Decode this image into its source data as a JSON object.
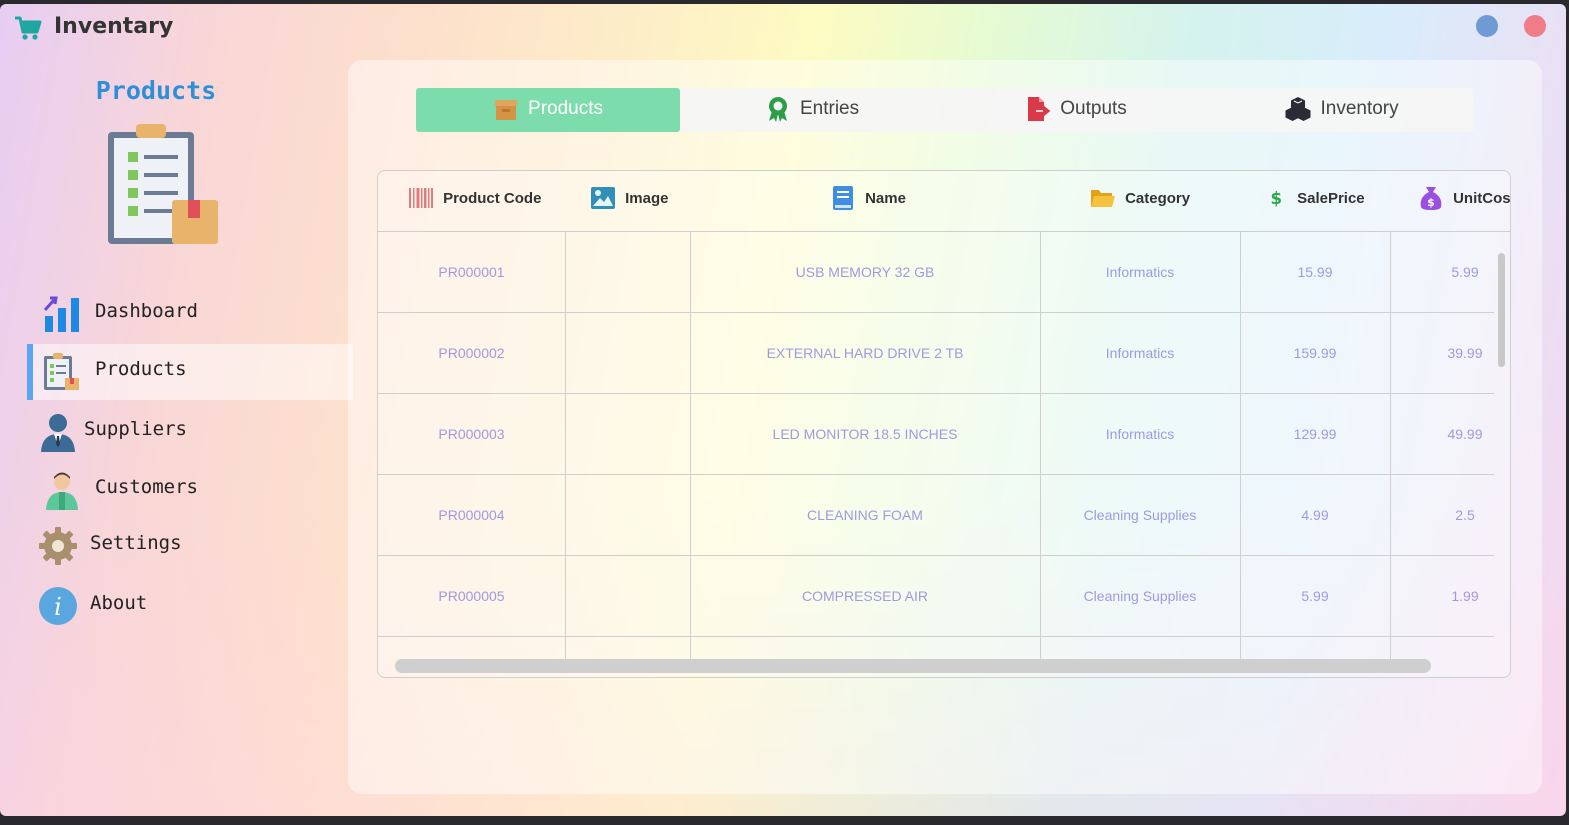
{
  "app": {
    "title": "Inventary"
  },
  "sidebar": {
    "title": "Products",
    "items": [
      {
        "label": "Dashboard",
        "icon": "chart-icon"
      },
      {
        "label": "Products",
        "icon": "clipboard-icon",
        "active": true
      },
      {
        "label": "Suppliers",
        "icon": "businessman-icon"
      },
      {
        "label": "Customers",
        "icon": "customer-icon"
      },
      {
        "label": "Settings",
        "icon": "gear-icon"
      },
      {
        "label": "About",
        "icon": "info-icon"
      }
    ]
  },
  "tabs": [
    {
      "label": "Products",
      "icon": "box-icon",
      "active": true
    },
    {
      "label": "Entries",
      "icon": "award-icon"
    },
    {
      "label": "Outputs",
      "icon": "file-export-icon"
    },
    {
      "label": "Inventory",
      "icon": "cubes-icon"
    }
  ],
  "table": {
    "columns": [
      {
        "label": "Product Code",
        "icon": "barcode-icon"
      },
      {
        "label": "Image",
        "icon": "image-icon"
      },
      {
        "label": "Name",
        "icon": "book-icon"
      },
      {
        "label": "Category",
        "icon": "folder-icon"
      },
      {
        "label": "SalePrice",
        "icon": "dollar-icon"
      },
      {
        "label": "UnitCost",
        "icon": "money-bag-icon"
      }
    ],
    "rows": [
      {
        "code": "PR000001",
        "image": "",
        "name": "USB MEMORY 32 GB",
        "category": "Informatics",
        "sale_price": "15.99",
        "unit_cost": "5.99"
      },
      {
        "code": "PR000002",
        "image": "",
        "name": "EXTERNAL HARD DRIVE 2 TB",
        "category": "Informatics",
        "sale_price": "159.99",
        "unit_cost": "39.99"
      },
      {
        "code": "PR000003",
        "image": "",
        "name": "LED MONITOR 18.5 INCHES",
        "category": "Informatics",
        "sale_price": "129.99",
        "unit_cost": "49.99"
      },
      {
        "code": "PR000004",
        "image": "",
        "name": "CLEANING FOAM",
        "category": "Cleaning Supplies",
        "sale_price": "4.99",
        "unit_cost": "2.5"
      },
      {
        "code": "PR000005",
        "image": "",
        "name": "COMPRESSED AIR",
        "category": "Cleaning Supplies",
        "sale_price": "5.99",
        "unit_cost": "1.99"
      }
    ]
  },
  "colors": {
    "accent_tab": "#7ddcac",
    "sidebar_title": "#2d8fd6",
    "cell_text": "#9f9ae0",
    "close_button": "#ef7c86",
    "minimize_button": "#6e9bd4"
  }
}
